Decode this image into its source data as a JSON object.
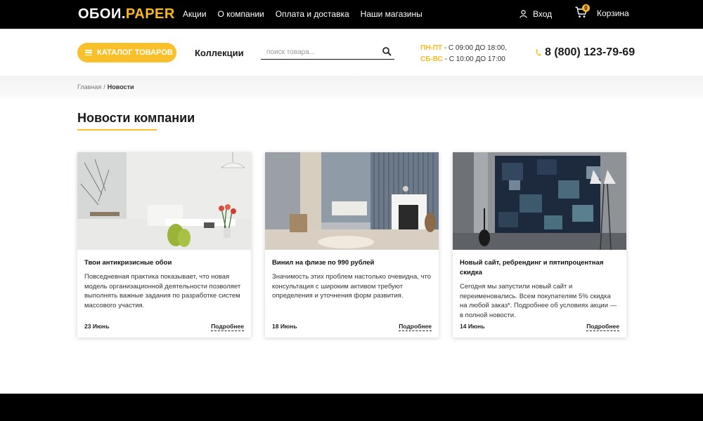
{
  "header": {
    "logo_main": "ОБОИ.",
    "logo_accent": "PAPER",
    "nav": [
      "Акции",
      "О компании",
      "Оплата и доставка",
      "Наши магазины"
    ],
    "login_label": "Вход",
    "cart_label": "Корзина",
    "cart_count": "0"
  },
  "toolbar": {
    "catalog_label": "КАТАЛОГ ТОВАРОВ",
    "collections_label": "Коллекции",
    "search_placeholder": "поиск товара...",
    "hours": [
      {
        "day": "ПН-ПТ",
        "time": " - С 09:00 ДО 18:00,"
      },
      {
        "day": "СБ-ВС",
        "time": " - С 10:00 ДО 17:00"
      }
    ],
    "phone": "8 (800) 123-79-69"
  },
  "breadcrumb": {
    "home": "Главная",
    "separator": "/",
    "current": "Новости"
  },
  "page": {
    "title": "Новости компании"
  },
  "news": [
    {
      "title": "Твои антикризисные обои",
      "text": "Повседневная практика показывает, что новая модель организационной деятельности позволяет выполнять важные задания по разработке систем массового участия.",
      "date": "23 Июнь",
      "more": "Подробнее"
    },
    {
      "title": "Винил на флизе по 990 рублей",
      "text": "Значимость этих проблем настолько очевидна, что консультация с широким активом требуют определения и уточнения форм развития.",
      "date": "18 Июнь",
      "more": "Подробнее"
    },
    {
      "title": "Новый сайт, ребрендинг и пятипроцентная скидка",
      "text": "Сегодня мы запустили новый сайт и переименовались. Всем покупателям 5% скидка на любой заказ*. Подробнее об условиях акции — в полной новости.",
      "date": "14 Июнь",
      "more": "Подробнее"
    }
  ],
  "colors": {
    "accent": "#f8c12b",
    "topbar": "#000000"
  }
}
